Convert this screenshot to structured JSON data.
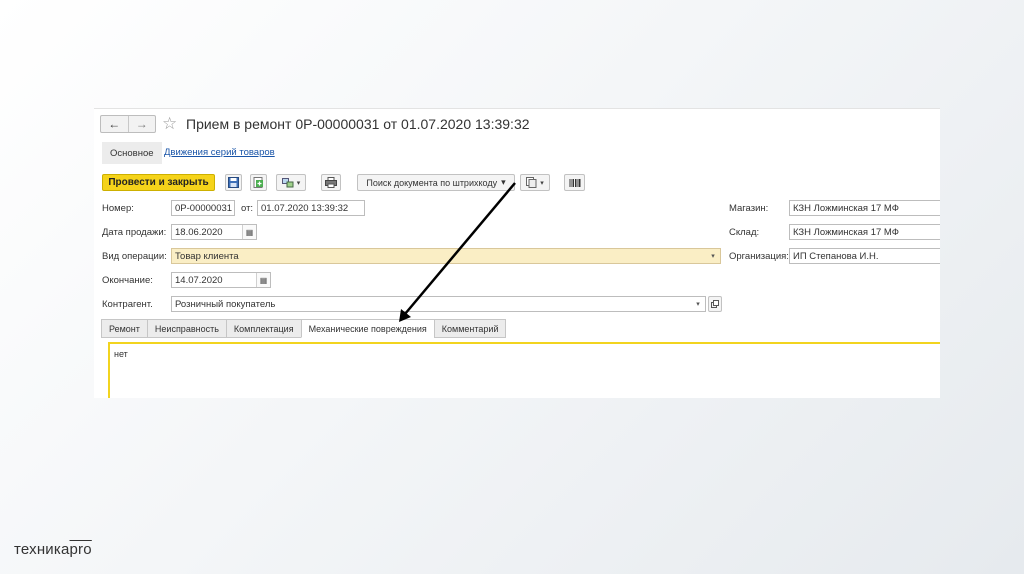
{
  "window": {
    "back": "←",
    "forward": "→",
    "star": "☆",
    "title": "Прием в ремонт 0Р-00000031 от 01.07.2020 13:39:32"
  },
  "nav_tabs": [
    {
      "label": "Основное"
    },
    {
      "label": "Движения серий товаров"
    }
  ],
  "toolbar": {
    "post_close": "Провести и закрыть",
    "barcode_search": "Поиск документа по штрихкоду",
    "dropdown_arrow": "▾"
  },
  "form": {
    "number_label": "Номер:",
    "number_value": "0Р-00000031",
    "from_label": "от:",
    "from_value": "01.07.2020 13:39:32",
    "sale_date_label": "Дата продажи:",
    "sale_date_value": "18.06.2020",
    "operation_label": "Вид операции:",
    "operation_value": "Товар клиента",
    "end_label": "Окончание:",
    "end_value": "14.07.2020",
    "counterparty_label": "Контрагент.",
    "counterparty_value": "Розничный покупатель",
    "store_label": "Магазин:",
    "store_value": "КЗН Ложминская 17 МФ",
    "warehouse_label": "Склад:",
    "warehouse_value": "КЗН Ложминская 17 МФ",
    "org_label": "Организация:",
    "org_value": "ИП Степанова И.Н."
  },
  "subtabs": [
    {
      "label": "Ремонт"
    },
    {
      "label": "Неисправность"
    },
    {
      "label": "Комплектация"
    },
    {
      "label": "Механические повреждения"
    },
    {
      "label": "Комментарий"
    }
  ],
  "textarea_value": "нет",
  "logo": {
    "prefix": "техника",
    "suffix": "pro"
  },
  "colors": {
    "accent": "#f5d31a",
    "link": "#1a55a8",
    "field_highlight": "#faeec5",
    "arrow": "#000000"
  },
  "icons": [
    "back-arrow-icon",
    "forward-arrow-icon",
    "star-icon",
    "save-icon",
    "document-green-icon",
    "structure-icon",
    "print-icon",
    "copy-icon",
    "barcode-icon",
    "calendar-icon",
    "dropdown-icon",
    "open-icon"
  ]
}
